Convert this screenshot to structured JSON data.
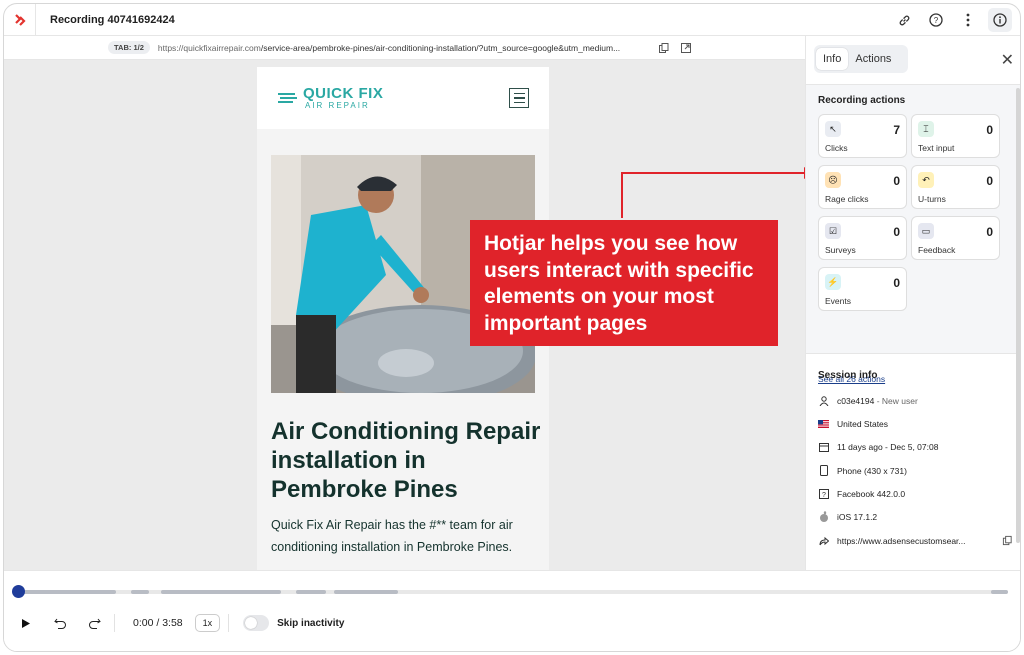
{
  "header": {
    "title": "Recording 40741692424"
  },
  "urlbar": {
    "tab": "TAB: 1/2",
    "url_prefix": "https://quickfixairrepair.com",
    "url_path": "/service-area/pembroke-pines/air-conditioning-installation/?utm_source=google&utm_medium..."
  },
  "site": {
    "brand_line1": "QUICK FIX",
    "brand_line2": "AIR REPAIR",
    "heading": "Air Conditioning Repair installation in Pembroke Pines",
    "paragraph": "Quick Fix Air Repair has the #** team for air conditioning installation in Pembroke Pines."
  },
  "callout": {
    "text": "Hotjar helps you see how users interact with specific elements on your most important pages"
  },
  "panel": {
    "tabs": [
      {
        "label": "Info"
      },
      {
        "label": "Actions"
      }
    ],
    "recording_actions_title": "Recording actions",
    "actions": [
      {
        "label": "Clicks",
        "count": "7",
        "icon": "cursor-click-icon",
        "color": "#e9ecf2"
      },
      {
        "label": "Text input",
        "count": "0",
        "icon": "text-input-icon",
        "color": "#dff3e9"
      },
      {
        "label": "Rage clicks",
        "count": "0",
        "icon": "angry-face-icon",
        "color": "#ffe2b5"
      },
      {
        "label": "U-turns",
        "count": "0",
        "icon": "u-turn-icon",
        "color": "#fff1b8"
      },
      {
        "label": "Surveys",
        "count": "0",
        "icon": "survey-icon",
        "color": "#e5e7f0"
      },
      {
        "label": "Feedback",
        "count": "0",
        "icon": "feedback-icon",
        "color": "#e5e7f0"
      },
      {
        "label": "Events",
        "count": "0",
        "icon": "lightning-icon",
        "color": "#d8f3f6"
      }
    ],
    "see_all": "See all 26 actions",
    "session_title": "Session info",
    "session": {
      "user_id": "c03e4194",
      "user_status": " - New user",
      "country": "United States",
      "date": "11 days ago - Dec 5, 07:08",
      "device": "Phone (430 x 731)",
      "browser": "Facebook 442.0.0",
      "os": "iOS 17.1.2",
      "referrer": "https://www.adsensecustomsear..."
    }
  },
  "player": {
    "time": "0:00 / 3:58",
    "speed": "1x",
    "skip_label": "Skip inactivity"
  }
}
